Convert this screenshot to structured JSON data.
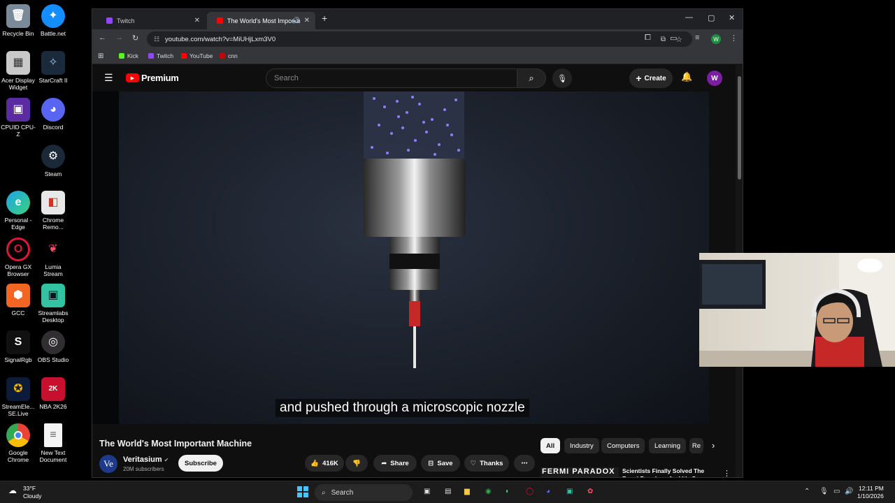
{
  "desktop": {
    "icons": [
      {
        "label": "Recycle Bin"
      },
      {
        "label": "Battle.net"
      },
      {
        "label": "Acer Display Widget"
      },
      {
        "label": "StarCraft II"
      },
      {
        "label": "CPUID CPU-Z"
      },
      {
        "label": "Discord"
      },
      {
        "label": "Steam"
      },
      {
        "label": "Personal - Edge"
      },
      {
        "label": "Chrome Remo..."
      },
      {
        "label": "Opera GX Browser"
      },
      {
        "label": "Lumia Stream"
      },
      {
        "label": "GCC"
      },
      {
        "label": "Streamlabs Desktop"
      },
      {
        "label": "SignalRgb"
      },
      {
        "label": "OBS Studio"
      },
      {
        "label": "StreamEle... SE.Live"
      },
      {
        "label": "NBA 2K26"
      },
      {
        "label": "Google Chrome"
      },
      {
        "label": "New Text Document"
      }
    ]
  },
  "browser": {
    "tabs": [
      {
        "label": "Twitch"
      },
      {
        "label": "The World's Most Importan"
      }
    ],
    "new_tab": "+",
    "url": "youtube.com/watch?v=MiUHjLxm3V0",
    "bookmarks": [
      {
        "label": "Kick",
        "color": "#53fc18"
      },
      {
        "label": "Twitch",
        "color": "#9146ff"
      },
      {
        "label": "YouTube",
        "color": "#ff0000"
      },
      {
        "label": "cnn",
        "color": "#cc0000"
      }
    ],
    "profile_initial": "W"
  },
  "youtube": {
    "logo_text": "Premium",
    "search_placeholder": "Search",
    "create_label": "Create",
    "avatar_initial": "W",
    "caption": "and pushed through a microscopic nozzle",
    "watermark": "Ve",
    "video_title": "The World's Most Important Machine",
    "channel": {
      "avatar_text": "Ve",
      "name": "Veritasium",
      "subscribers": "20M subscribers"
    },
    "subscribe_label": "Subscribe",
    "actions": {
      "likes": "416K",
      "share": "Share",
      "save": "Save",
      "thanks": "Thanks"
    },
    "chips": [
      {
        "label": "All"
      },
      {
        "label": "Industry"
      },
      {
        "label": "Computers"
      },
      {
        "label": "Learning"
      },
      {
        "label": "Re"
      }
    ],
    "recommended": {
      "thumb_text": "FERMI PARADOX",
      "title": "Scientists Finally Solved The Fermi Paradox - And It's Scary"
    }
  },
  "taskbar": {
    "weather_temp": "33°F",
    "weather_text": "Cloudy",
    "search_label": "Search",
    "time": "12:11 PM",
    "date": "1/10/2026"
  },
  "colors": {
    "yt_red": "#ff0000",
    "bg": "#0f0f0f",
    "chip_bg": "#272727",
    "accent_purple": "#7b1fa2"
  }
}
